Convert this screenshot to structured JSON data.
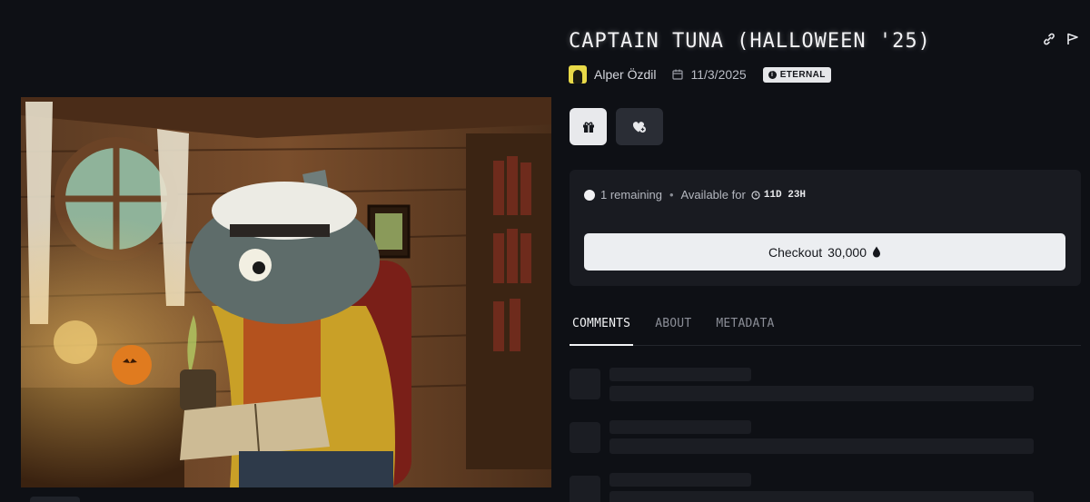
{
  "artwork": {
    "alt_name": "artwork-image"
  },
  "header": {
    "title": "CAPTAIN TUNA (HALLOWEEN '25)",
    "icons": [
      "link-icon",
      "flag-icon"
    ]
  },
  "meta": {
    "author": "Alper Özdil",
    "date": "11/3/2025",
    "badge": "ETERNAL"
  },
  "actions": {
    "icons": [
      "gift-icon",
      "heart-add-icon"
    ]
  },
  "purchase": {
    "remaining": "1 remaining",
    "available_label": "Available for",
    "time_left": "11D 23H",
    "checkout_label": "Checkout",
    "price": "30,000"
  },
  "tabs": [
    {
      "label": "COMMENTS",
      "active": true
    },
    {
      "label": "ABOUT",
      "active": false
    },
    {
      "label": "METADATA",
      "active": false
    }
  ],
  "colors": {
    "background": "#0e1015",
    "panel": "#191b21",
    "button_light": "#eceef1",
    "skeleton": "#1b1d23"
  }
}
